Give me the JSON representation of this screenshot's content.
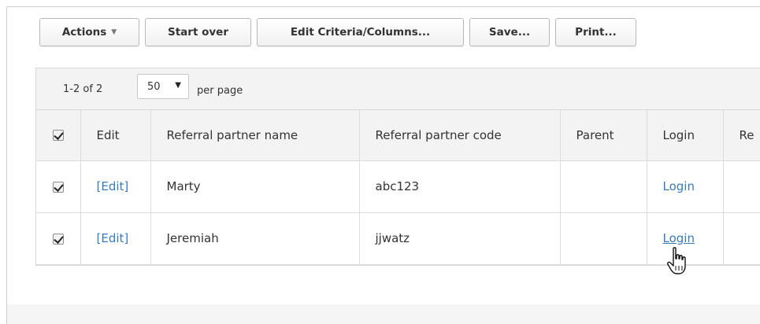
{
  "toolbar": {
    "actions_label": "Actions",
    "start_over_label": "Start over",
    "edit_criteria_label": "Edit Criteria/Columns...",
    "save_label": "Save...",
    "print_label": "Print..."
  },
  "pager": {
    "count": "1-2 of 2",
    "per_page_value": "50",
    "per_page_label": "per page"
  },
  "table": {
    "columns": [
      "Edit",
      "Referral partner name",
      "Referral partner code",
      "Parent",
      "Login",
      "Re"
    ],
    "rows": [
      {
        "selected": true,
        "edit": "[Edit]",
        "name": "Marty",
        "code": "abc123",
        "parent": "",
        "login": "Login"
      },
      {
        "selected": true,
        "edit": "[Edit]",
        "name": "Jeremiah",
        "code": "jjwatz",
        "parent": "",
        "login": "Login"
      }
    ]
  },
  "colors": {
    "link": "#3a7ab8",
    "header_bg": "#f3f3f3",
    "border": "#dcdcdc"
  },
  "icons": {
    "actions_caret": "chevron-down-icon",
    "select_arrow": "triangle-down-icon",
    "cursor": "hand-pointer-icon"
  }
}
